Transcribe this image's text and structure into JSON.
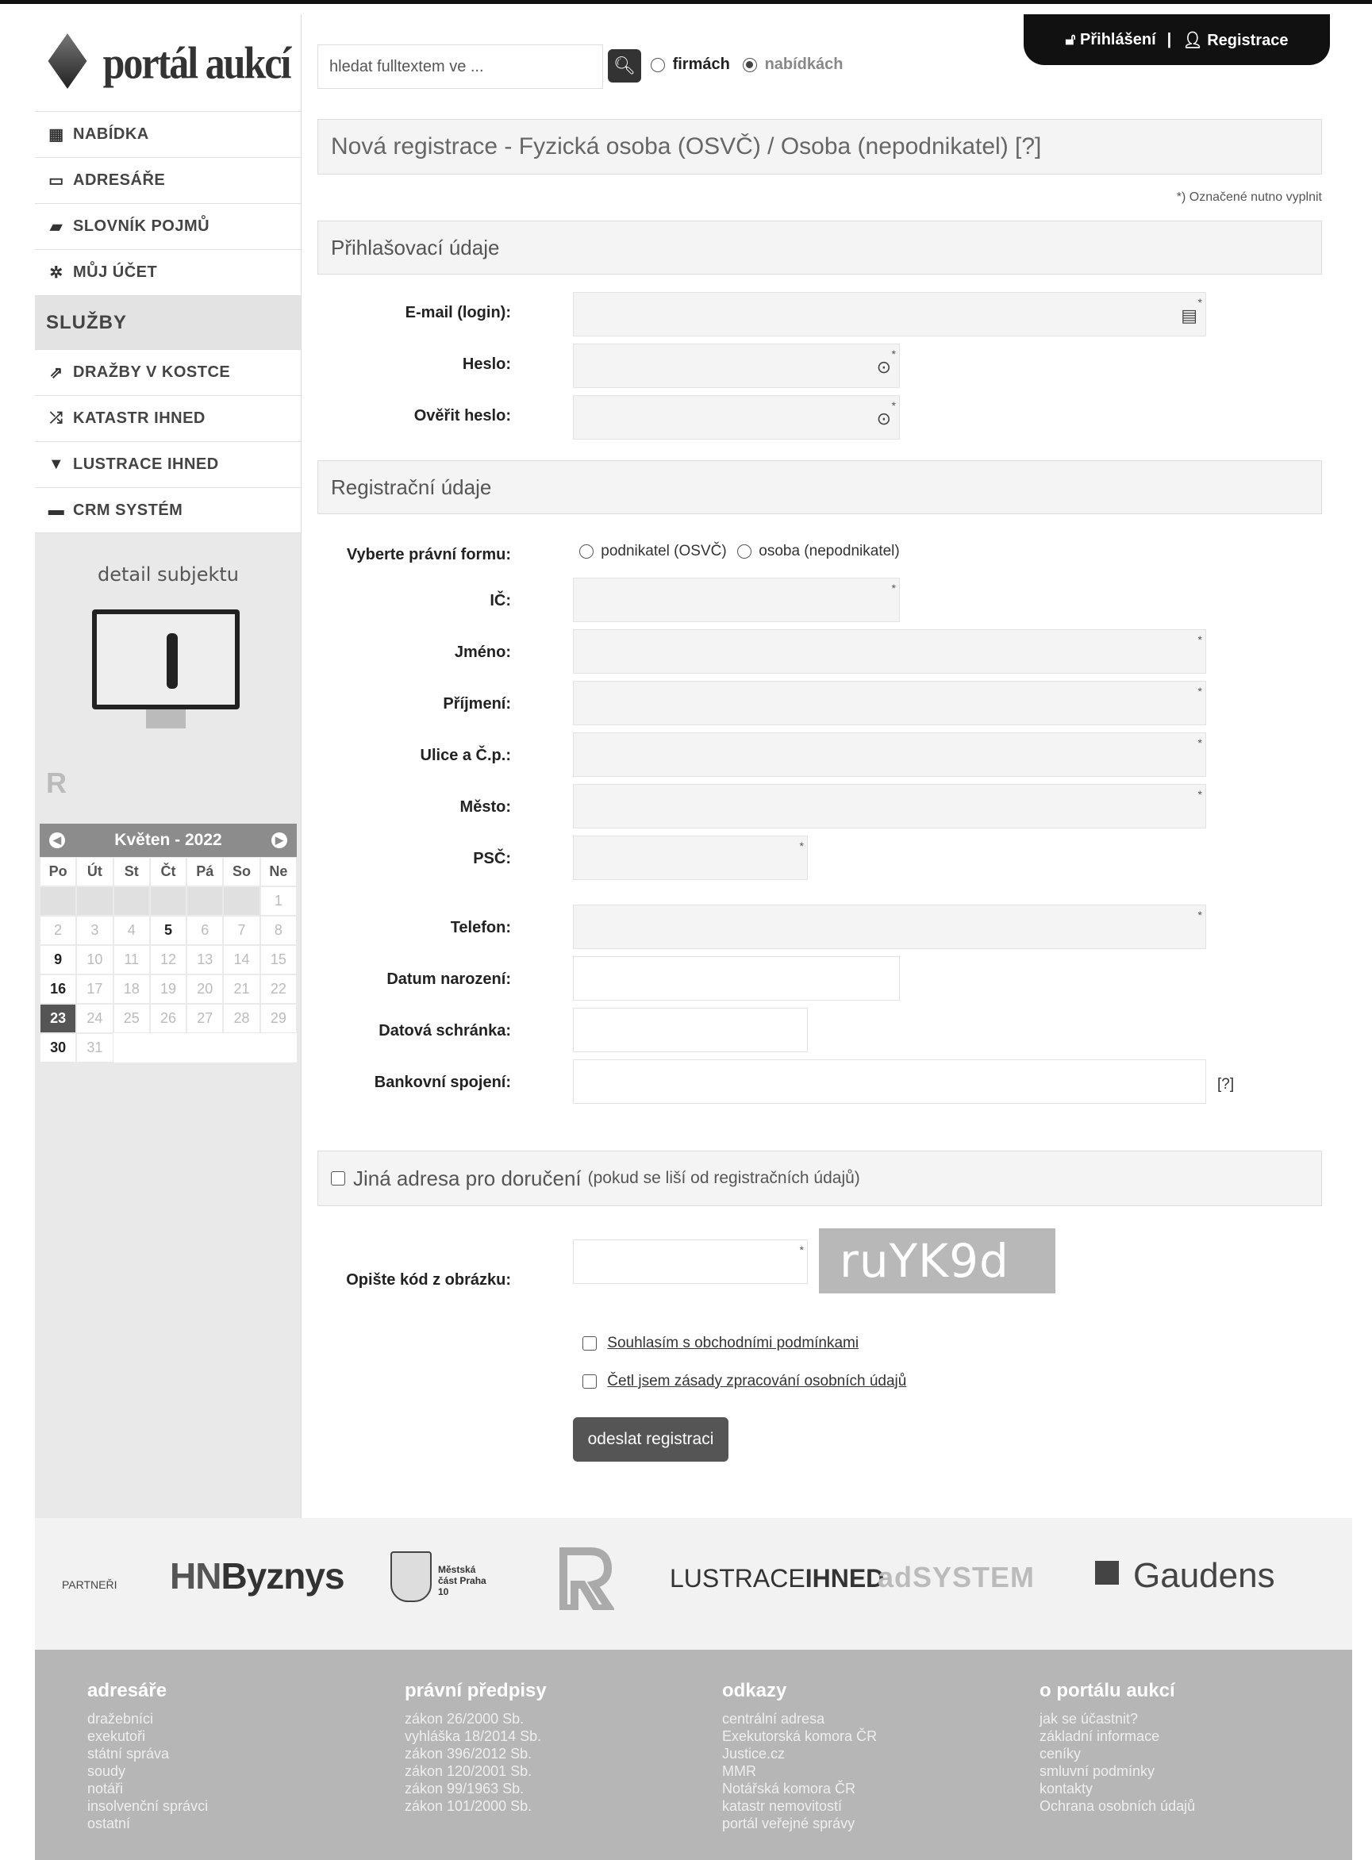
{
  "brand": {
    "logo_text": "portál aukcí"
  },
  "sidebar": {
    "items": [
      {
        "icon": "grid-icon",
        "label": "NABÍDKA"
      },
      {
        "icon": "folder-icon",
        "label": "ADRESÁŘE"
      },
      {
        "icon": "book-icon",
        "label": "SLOVNÍK POJMŮ"
      },
      {
        "icon": "gear-icon",
        "label": "MŮJ ÚČET"
      }
    ],
    "services_title": "SLUŽBY",
    "services": [
      {
        "icon": "external-link-icon",
        "label": "DRAŽBY V KOSTCE"
      },
      {
        "icon": "shuffle-icon",
        "label": "KATASTR IHNED"
      },
      {
        "icon": "filter-icon",
        "label": "LUSTRACE IHNED"
      },
      {
        "icon": "monitor-icon",
        "label": "CRM SYSTÉM"
      }
    ],
    "promo_title": "detail subjektu"
  },
  "calendar": {
    "title": "Květen - 2022",
    "day_headers": [
      "Po",
      "Út",
      "St",
      "Čt",
      "Pá",
      "So",
      "Ne"
    ],
    "weeks": [
      [
        "",
        "",
        "",
        "",
        "",
        "",
        "1"
      ],
      [
        "2",
        "3",
        "4",
        "5",
        "6",
        "7",
        "8"
      ],
      [
        "9",
        "10",
        "11",
        "12",
        "13",
        "14",
        "15"
      ],
      [
        "16",
        "17",
        "18",
        "19",
        "20",
        "21",
        "22"
      ],
      [
        "23",
        "24",
        "25",
        "26",
        "27",
        "28",
        "29"
      ],
      [
        "30",
        "31",
        "",
        "",
        "",
        "",
        ""
      ]
    ],
    "bold_days": [
      "5",
      "9",
      "16",
      "30"
    ],
    "today": "23"
  },
  "search": {
    "placeholder": "hledat fulltextem ve ...",
    "option_firms": "firmách",
    "option_offers": "nabídkách",
    "selected": "nabídkách"
  },
  "auth": {
    "login": "Přihlášení",
    "separator": "|",
    "register": "Registrace"
  },
  "form": {
    "title": "Nová registrace - Fyzická osoba (OSVČ) / Osoba (nepodnikatel) [?]",
    "required_note": "*) Označené nutno vyplnit",
    "login_section": "Přihlašovací údaje",
    "email_label": "E-mail (login):",
    "password_label": "Heslo:",
    "password_confirm_label": "Ověřit heslo:",
    "reg_section": "Registrační údaje",
    "legal_form_label": "Vyberte právní formu:",
    "legal_form_option1": "podnikatel (OSVČ)",
    "legal_form_option2": "osoba (nepodnikatel)",
    "ic_label": "IČ:",
    "first_name_label": "Jméno:",
    "last_name_label": "Příjmení:",
    "street_label": "Ulice a Č.p.:",
    "city_label": "Město:",
    "zip_label": "PSČ:",
    "phone_label": "Telefon:",
    "birth_label": "Datum narození:",
    "databox_label": "Datová schránka:",
    "bank_label": "Bankovní spojení:",
    "bank_help": "[?]",
    "alt_address_title": "Jiná adresa pro doručení",
    "alt_address_note": "(pokud se liší od registračních údajů)",
    "captcha_label": "Opište kód z obrázku:",
    "captcha_text": "ruYK9d",
    "agree_terms": "Souhlasím s obchodními podmínkami",
    "agree_privacy": "Četl jsem zásady zpracování osobních údajů",
    "submit": "odeslat registraci",
    "required_mark": "*"
  },
  "partners": {
    "label": "PARTNEŘI",
    "hn_a": "HN",
    "hn_b": "Byznys",
    "praha": "Městská část Praha 10",
    "lustrace_a": "LUSTRACE",
    "lustrace_b": "IHNED",
    "adsystem": "adSYSTEM",
    "gaudens": "Gaudens"
  },
  "footer": {
    "columns": [
      {
        "title": "adresáře",
        "links": [
          "dražebníci",
          "exekutoři",
          "státní správa",
          "soudy",
          "notáři",
          "insolvenční správci",
          "ostatní"
        ]
      },
      {
        "title": "právní předpisy",
        "links": [
          "zákon 26/2000 Sb.",
          "vyhláška 18/2014 Sb.",
          "zákon 396/2012 Sb.",
          "zákon 120/2001 Sb.",
          "zákon 99/1963 Sb.",
          "zákon 101/2000 Sb."
        ]
      },
      {
        "title": "odkazy",
        "links": [
          "centrální adresa",
          "Exekutorská komora ČR",
          "Justice.cz",
          "MMR",
          "Notářská komora ČR",
          "katastr nemovitostí",
          "portál veřejné správy"
        ]
      },
      {
        "title": "o portálu aukcí",
        "links": [
          "jak se účastnit?",
          "základní informace",
          "ceníky",
          "smluvní podmínky",
          "kontakty",
          "Ochrana osobních údajů"
        ]
      }
    ]
  }
}
